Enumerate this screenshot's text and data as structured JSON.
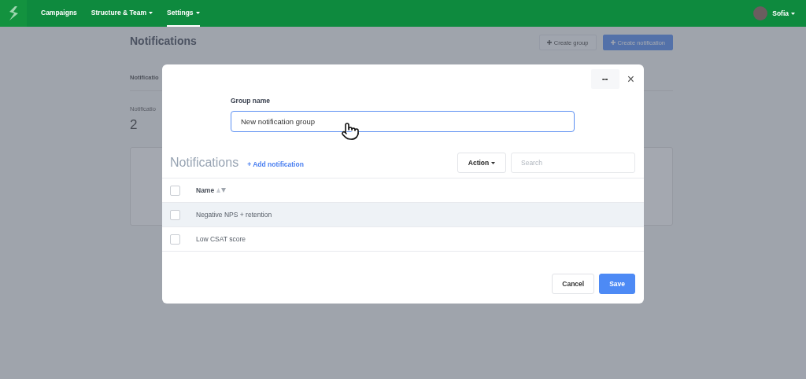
{
  "nav": {
    "items": [
      {
        "label": "Campaigns",
        "dropdown": false,
        "selected": false
      },
      {
        "label": "Structure & Team",
        "dropdown": true,
        "selected": false
      },
      {
        "label": "Settings",
        "dropdown": true,
        "selected": true
      }
    ],
    "user": "Sofia"
  },
  "page": {
    "title": "Notifications",
    "buttons": [
      {
        "label": "Create group",
        "kind": "secondary"
      },
      {
        "label": "Create notification",
        "kind": "primary"
      }
    ],
    "section_label": "Notificatio",
    "count_label": "Notificatio",
    "count": "2"
  },
  "modal": {
    "more": "•••",
    "close": "×",
    "group_label": "Group name",
    "group_value": "New notification group",
    "list_title": "Notifications",
    "add_link": "+ Add notification",
    "action": "Action",
    "search_placeholder": "Search",
    "column": "Name",
    "header_checked": false,
    "rows": [
      {
        "name": "Negative NPS + retention",
        "checked": false,
        "hovered": true
      },
      {
        "name": "Low CSAT score",
        "checked": false,
        "hovered": false
      }
    ],
    "buttons": [
      {
        "label": "Cancel",
        "kind": "secondary"
      },
      {
        "label": "Save",
        "kind": "primary"
      }
    ]
  }
}
